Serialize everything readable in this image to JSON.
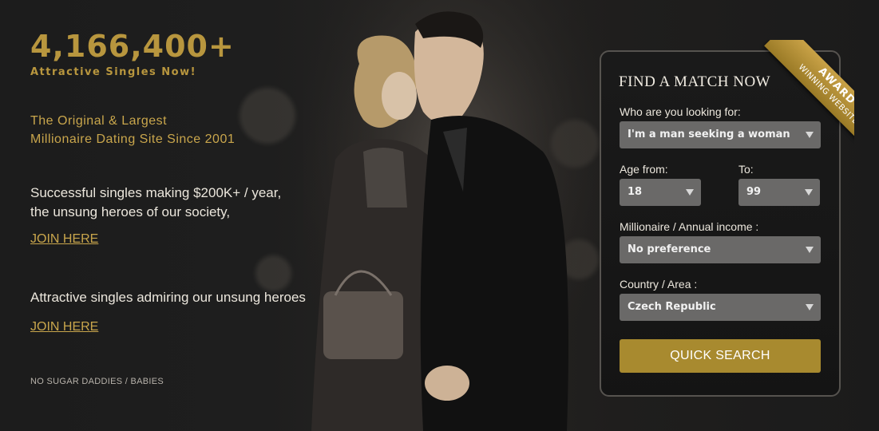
{
  "stats": {
    "count": "4,166,400+",
    "subtitle": "Attractive Singles Now!"
  },
  "tagline": {
    "line1": "The Original & Largest",
    "line2": "Millionaire Dating Site Since 2001"
  },
  "pitch1": {
    "line1": "Successful singles making $200K+ / year,",
    "line2": "the unsung heroes of our society,",
    "link": "JOIN HERE"
  },
  "pitch2": {
    "line1": "Attractive singles admiring our unsung heroes",
    "link": "JOIN HERE"
  },
  "disclaimer": "NO SUGAR DADDIES / BABIES",
  "search": {
    "title": "FIND A MATCH NOW",
    "looking_label": "Who are you looking for:",
    "looking_value": "I'm a man seeking a woman",
    "age_from_label": "Age from:",
    "age_from_value": "18",
    "age_to_label": "To:",
    "age_to_value": "99",
    "income_label": "Millionaire / Annual income :",
    "income_value": "No preference",
    "country_label": "Country / Area :",
    "country_value": "Czech Republic",
    "button": "QUICK SEARCH"
  },
  "award": {
    "line1": "AWARD",
    "line2": "WINNING WEBSITE"
  },
  "colors": {
    "gold": "#b8963e",
    "button": "#a88a2f",
    "select": "#6a6968",
    "background": "#1a1a1a"
  }
}
